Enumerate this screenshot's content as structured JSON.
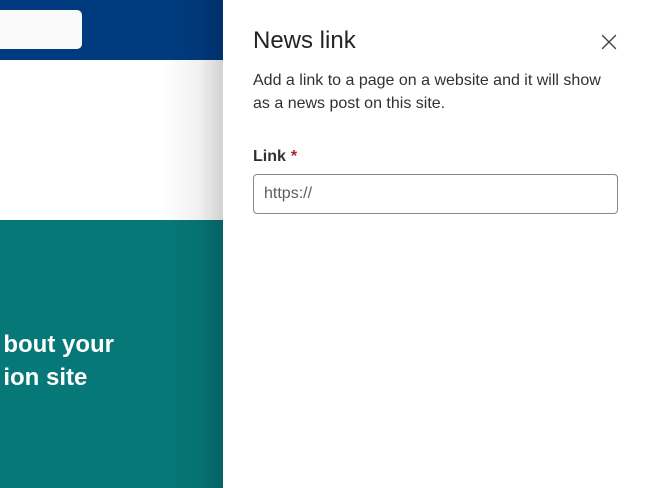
{
  "background": {
    "hero_line1": "bout your",
    "hero_line2": "ion site"
  },
  "panel": {
    "title": "News link",
    "description": "Add a link to a page on a website and it will show as a news post on this site.",
    "close_icon": "close-icon",
    "link_field": {
      "label": "Link",
      "required_marker": "*",
      "value": "",
      "placeholder": "https://"
    }
  },
  "colors": {
    "header": "#003b80",
    "hero": "#077878",
    "required": "#a4262c"
  }
}
